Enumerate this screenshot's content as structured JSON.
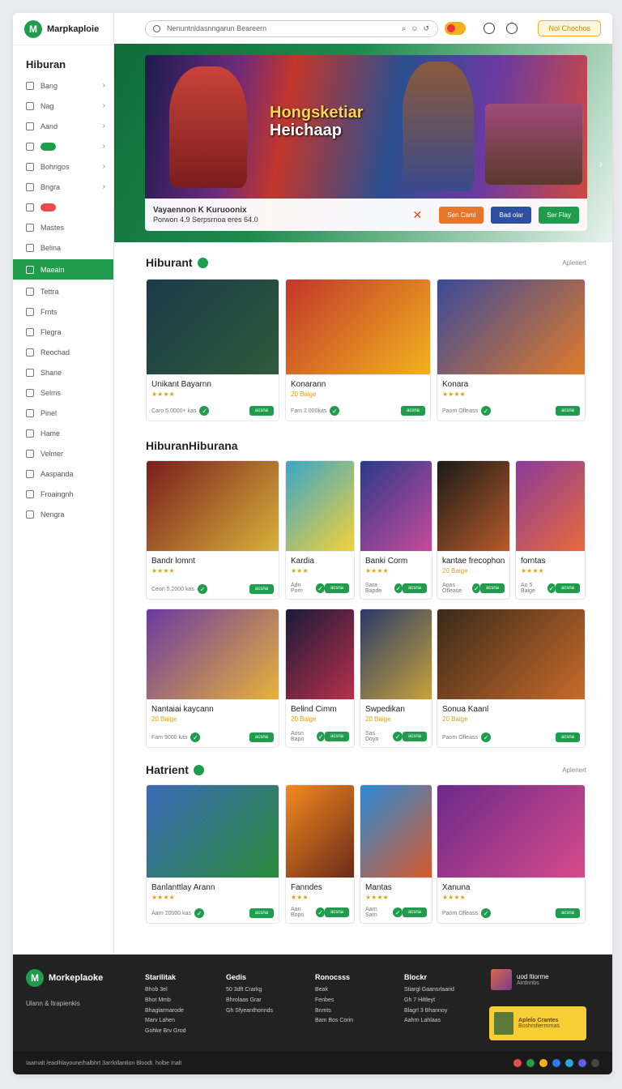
{
  "brand": {
    "name": "Marpkaploie",
    "accent": "#1f9d4d"
  },
  "search": {
    "placeholder": "Nenuntnldasnngarun Beareern"
  },
  "topbar": {
    "button_label": "Nol Chochos"
  },
  "sidebar": {
    "heading": "Hiburan",
    "items": [
      {
        "label": "Bang",
        "chevron": true
      },
      {
        "label": "Nag",
        "chevron": true
      },
      {
        "label": "Aand",
        "chevron": true
      },
      {
        "label": "",
        "pill": "",
        "pill_color": "#1f9d4d",
        "chevron": true
      },
      {
        "label": "Bohrigos",
        "chevron": true
      },
      {
        "label": "Bngra",
        "chevron": true
      },
      {
        "label": "",
        "pill": "",
        "pill_color": "#e84c4c",
        "chevron": false
      },
      {
        "label": "Mastes",
        "chevron": false
      },
      {
        "label": "Belina",
        "chevron": false
      },
      {
        "label": "Maeain",
        "chevron": false,
        "active": true
      },
      {
        "label": "Tettra",
        "chevron": false
      },
      {
        "label": "Frnts",
        "chevron": false
      },
      {
        "label": "Flegra",
        "chevron": false
      },
      {
        "label": "Reochad",
        "chevron": false
      },
      {
        "label": "Shane",
        "chevron": false
      },
      {
        "label": "Selms",
        "chevron": false
      },
      {
        "label": "Pinel",
        "chevron": false
      },
      {
        "label": "Hame",
        "chevron": false
      },
      {
        "label": "Velmer",
        "chevron": false
      },
      {
        "label": "Aaspanda",
        "chevron": false
      },
      {
        "label": "Froaingnh",
        "chevron": false
      },
      {
        "label": "Nengra",
        "chevron": false
      }
    ]
  },
  "hero": {
    "title_line1": "Hongsketiar",
    "title_line2": "Heichaap",
    "bar_title": "Vayaennon K Kuruoonix",
    "bar_sub": "Porwon 4.9 Serpsrnoa eres 64.0",
    "buttons": [
      {
        "label": "Sen Caml",
        "color": "#e8762a"
      },
      {
        "label": "Bad olar",
        "color": "#2c4fa0"
      },
      {
        "label": "Ser Flay",
        "color": "#1f9d4d"
      }
    ]
  },
  "sections": [
    {
      "title": "Hiburant",
      "see_all": "Aplenert"
    },
    {
      "title": "HiburanHiburana",
      "see_all": ""
    },
    {
      "title": "Hatrient",
      "see_all": "Aplenert"
    }
  ],
  "cards": [
    {
      "title": "Unikant Bayarnn",
      "sub": "★★★★",
      "foot": "Caro 5.0000+ kas",
      "btn": "acsna"
    },
    {
      "title": "Konarann",
      "sub": "20 Baige",
      "foot": "Fam 2.000kas",
      "btn": "acsna"
    },
    {
      "title": "Konara",
      "sub": "★★★★",
      "foot": "Paom Ofleass",
      "btn": "acsna"
    },
    {
      "title": "Bandr lomnt",
      "sub": "★★★★",
      "foot": "Ceon 5.2000 kas",
      "btn": "acsna"
    },
    {
      "title": "Kardia",
      "sub": "★★★",
      "foot": "Adn Porn",
      "btn": "acsna"
    },
    {
      "title": "Banki Corm",
      "sub": "★★★★",
      "foot": "Sara Bapde",
      "btn": "acsna"
    },
    {
      "title": "kantae frecophon",
      "sub": "20 Baige",
      "foot": "Aoas Oflease",
      "btn": "acsna"
    },
    {
      "title": "forntas",
      "sub": "★★★★",
      "foot": "Ao 5 Baige",
      "btn": "acsna"
    },
    {
      "title": "Nantaiai kaycann",
      "sub": "20 Baige",
      "foot": "Fam 9000 kas",
      "btn": "acsna"
    },
    {
      "title": "Belind Cimm",
      "sub": "20 Baige",
      "foot": "Aosn Bapo",
      "btn": "acsna"
    },
    {
      "title": "Swpedikan",
      "sub": "20 Baige",
      "foot": "Sas Doyn",
      "btn": "acsna"
    },
    {
      "title": "Sonua Kaanl",
      "sub": "20 Baige",
      "foot": "Paom Ofleass",
      "btn": "acsna"
    },
    {
      "title": "Banlanttlay Arann",
      "sub": "★★★★",
      "foot": "Aarn 20000 kas",
      "btn": "acsna"
    },
    {
      "title": "Fanndes",
      "sub": "★★★",
      "foot": "Aan Bopo",
      "btn": "acsna"
    },
    {
      "title": "Mantas",
      "sub": "★★★★",
      "foot": "Aarn Sarn",
      "btn": "acsna"
    },
    {
      "title": "Xanuna",
      "sub": "★★★★",
      "foot": "Paom Ofleass",
      "btn": "acsna"
    }
  ],
  "footer": {
    "brand": "Morkeplaoke",
    "tagline": "Ulann & ltrapienkis",
    "columns": [
      {
        "title": "Starilitak",
        "items": [
          "Bhob 3el",
          "Bhot Mmb",
          "Bhaglarmarode",
          "Marv Lahen",
          "Gohke Brv Grod"
        ]
      },
      {
        "title": "Gedis",
        "items": [
          "50 3dft Crarkg",
          "Bhrolaas Grar",
          "Gh Sfyeanthonnds"
        ]
      },
      {
        "title": "Ronocsss",
        "items": [
          "Beak",
          "Fenbes",
          "Bnmts",
          "Bam Bos Corin"
        ]
      },
      {
        "title": "Blockr",
        "items": [
          "Stiargl Gaansrlaarid",
          "Gh 7 Hiltleyt",
          "Blagrl 3 Bhannoy",
          "Aahrn Lahlaas"
        ]
      }
    ],
    "profile_name": "uod ltiorme",
    "profile_sub": "Airdnnbs",
    "promo_title": "Aplelo Crantes",
    "promo_sub": "Boshrsfiermrnas",
    "bottom_text": "Iaarnalt /eaolhlayoune/halbhrt 3arrlollantion Bloodt. holbe Inalt",
    "social_colors": [
      "#e84c4c",
      "#1f9d4d",
      "#f2b01e",
      "#2c7be5",
      "#2aa6d6",
      "#5b5ee8",
      "#444"
    ]
  }
}
